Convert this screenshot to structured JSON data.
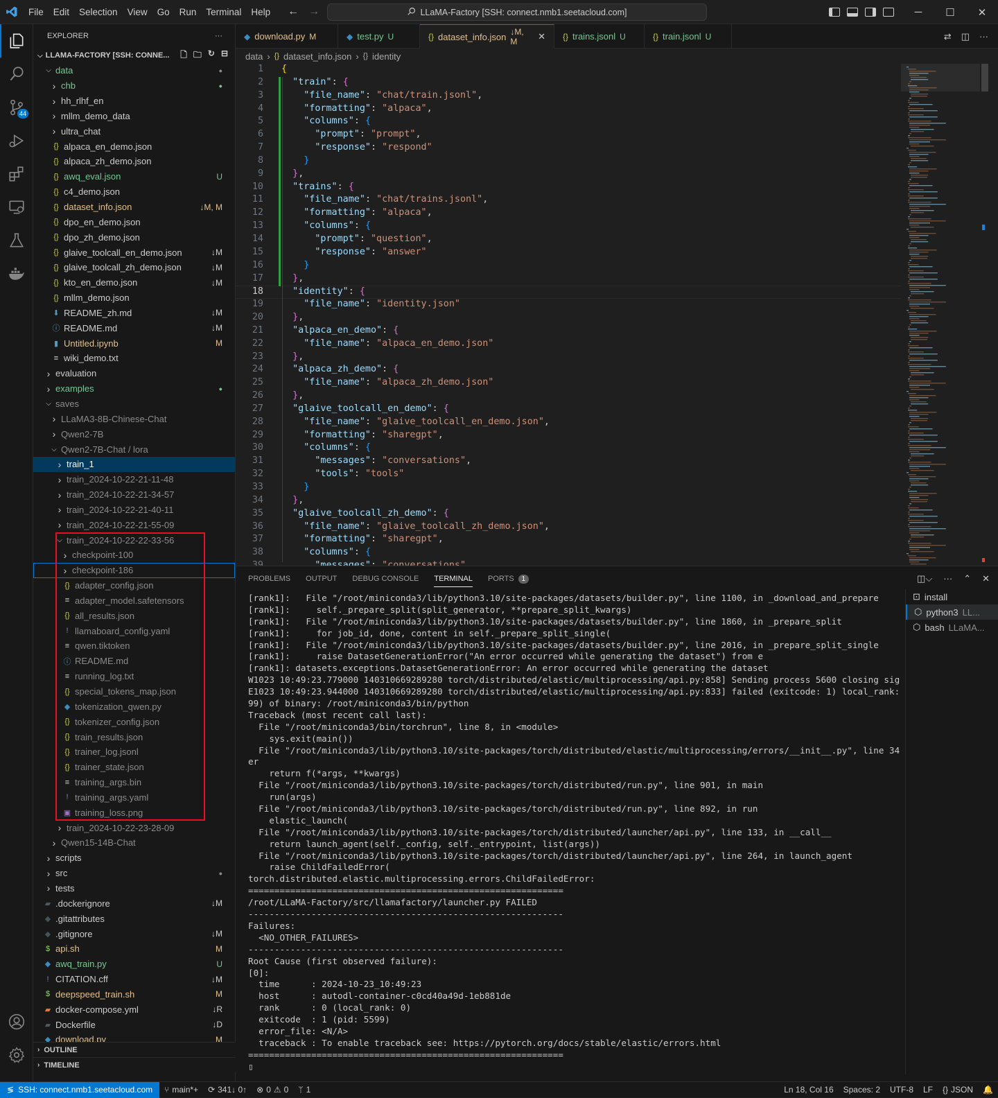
{
  "menu": [
    "File",
    "Edit",
    "Selection",
    "View",
    "Go",
    "Run",
    "Terminal",
    "Help"
  ],
  "window_title": "LLaMA-Factory [SSH: connect.nmb1.seetacloud.com]",
  "activity": {
    "scm_badge": "44"
  },
  "explorer": {
    "header": "EXPLORER",
    "more": "···",
    "root": "LLAMA-FACTORY [SSH: CONNE...",
    "items": [
      {
        "label": "data",
        "depth": 0,
        "type": "folder-open",
        "color": "#73c991",
        "status": "●",
        "status_color": "#8b8b8b"
      },
      {
        "label": "chb",
        "depth": 1,
        "type": "folder",
        "color": "#73c991",
        "status": "●",
        "status_color": "#73c991"
      },
      {
        "label": "hh_rlhf_en",
        "depth": 1,
        "type": "folder",
        "color": "#cccccc",
        "status": ""
      },
      {
        "label": "mllm_demo_data",
        "depth": 1,
        "type": "folder",
        "color": "#cccccc",
        "status": ""
      },
      {
        "label": "ultra_chat",
        "depth": 1,
        "type": "folder",
        "color": "#cccccc",
        "status": ""
      },
      {
        "label": "alpaca_en_demo.json",
        "depth": 1,
        "type": "json",
        "color": "#cccccc",
        "status": ""
      },
      {
        "label": "alpaca_zh_demo.json",
        "depth": 1,
        "type": "json",
        "color": "#cccccc",
        "status": ""
      },
      {
        "label": "awq_eval.json",
        "depth": 1,
        "type": "json",
        "color": "#73c991",
        "status": "U",
        "status_color": "#73c991"
      },
      {
        "label": "c4_demo.json",
        "depth": 1,
        "type": "json",
        "color": "#cccccc",
        "status": ""
      },
      {
        "label": "dataset_info.json",
        "depth": 1,
        "type": "json",
        "color": "#e2c08d",
        "status": "↓M, M",
        "status_color": "#e2c08d"
      },
      {
        "label": "dpo_en_demo.json",
        "depth": 1,
        "type": "json",
        "color": "#cccccc",
        "status": ""
      },
      {
        "label": "dpo_zh_demo.json",
        "depth": 1,
        "type": "json",
        "color": "#cccccc",
        "status": ""
      },
      {
        "label": "glaive_toolcall_en_demo.json",
        "depth": 1,
        "type": "json",
        "color": "#cccccc",
        "status": "↓M",
        "status_color": "#cccccc"
      },
      {
        "label": "glaive_toolcall_zh_demo.json",
        "depth": 1,
        "type": "json",
        "color": "#cccccc",
        "status": "↓M",
        "status_color": "#cccccc"
      },
      {
        "label": "kto_en_demo.json",
        "depth": 1,
        "type": "json",
        "color": "#cccccc",
        "status": "↓M",
        "status_color": "#cccccc"
      },
      {
        "label": "mllm_demo.json",
        "depth": 1,
        "type": "json",
        "color": "#cccccc",
        "status": ""
      },
      {
        "label": "README_zh.md",
        "depth": 1,
        "type": "md-down",
        "color": "#cccccc",
        "status": "↓M",
        "status_color": "#cccccc"
      },
      {
        "label": "README.md",
        "depth": 1,
        "type": "info",
        "color": "#cccccc",
        "status": "↓M",
        "status_color": "#cccccc"
      },
      {
        "label": "Untitled.ipynb",
        "depth": 1,
        "type": "notebook",
        "color": "#e2c08d",
        "status": "M",
        "status_color": "#e2c08d"
      },
      {
        "label": "wiki_demo.txt",
        "depth": 1,
        "type": "text",
        "color": "#cccccc",
        "status": ""
      },
      {
        "label": "evaluation",
        "depth": 0,
        "type": "folder",
        "color": "#cccccc",
        "status": ""
      },
      {
        "label": "examples",
        "depth": 0,
        "type": "folder",
        "color": "#73c991",
        "status": "●",
        "status_color": "#73c991"
      },
      {
        "label": "saves",
        "depth": 0,
        "type": "folder-open",
        "color": "#8b8b8b",
        "status": ""
      },
      {
        "label": "LLaMA3-8B-Chinese-Chat",
        "depth": 1,
        "type": "folder",
        "color": "#8b8b8b",
        "status": ""
      },
      {
        "label": "Qwen2-7B",
        "depth": 1,
        "type": "folder",
        "color": "#8b8b8b",
        "status": ""
      },
      {
        "label": "Qwen2-7B-Chat / lora",
        "depth": 1,
        "type": "folder-open",
        "color": "#8b8b8b",
        "status": ""
      },
      {
        "label": "train_1",
        "depth": 2,
        "type": "folder",
        "color": "#ffffff",
        "status": "",
        "selected": true
      },
      {
        "label": "train_2024-10-22-21-11-48",
        "depth": 2,
        "type": "folder",
        "color": "#8b8b8b",
        "status": ""
      },
      {
        "label": "train_2024-10-22-21-34-57",
        "depth": 2,
        "type": "folder",
        "color": "#8b8b8b",
        "status": ""
      },
      {
        "label": "train_2024-10-22-21-40-11",
        "depth": 2,
        "type": "folder",
        "color": "#8b8b8b",
        "status": ""
      },
      {
        "label": "train_2024-10-22-21-55-09",
        "depth": 2,
        "type": "folder",
        "color": "#8b8b8b",
        "status": ""
      },
      {
        "label": "train_2024-10-22-22-33-56",
        "depth": 2,
        "type": "folder-open",
        "color": "#8b8b8b",
        "status": ""
      },
      {
        "label": "checkpoint-100",
        "depth": 3,
        "type": "folder",
        "color": "#8b8b8b",
        "status": ""
      },
      {
        "label": "checkpoint-186",
        "depth": 3,
        "type": "folder",
        "color": "#8b8b8b",
        "status": "",
        "focus": true
      },
      {
        "label": "adapter_config.json",
        "depth": 3,
        "type": "json",
        "color": "#8b8b8b",
        "status": ""
      },
      {
        "label": "adapter_model.safetensors",
        "depth": 3,
        "type": "text",
        "color": "#8b8b8b",
        "status": ""
      },
      {
        "label": "all_results.json",
        "depth": 3,
        "type": "json",
        "color": "#8b8b8b",
        "status": ""
      },
      {
        "label": "llamaboard_config.yaml",
        "depth": 3,
        "type": "yaml",
        "color": "#8b8b8b",
        "status": ""
      },
      {
        "label": "qwen.tiktoken",
        "depth": 3,
        "type": "text",
        "color": "#8b8b8b",
        "status": ""
      },
      {
        "label": "README.md",
        "depth": 3,
        "type": "info",
        "color": "#8b8b8b",
        "status": ""
      },
      {
        "label": "running_log.txt",
        "depth": 3,
        "type": "text",
        "color": "#8b8b8b",
        "status": ""
      },
      {
        "label": "special_tokens_map.json",
        "depth": 3,
        "type": "json",
        "color": "#8b8b8b",
        "status": ""
      },
      {
        "label": "tokenization_qwen.py",
        "depth": 3,
        "type": "python",
        "color": "#8b8b8b",
        "status": ""
      },
      {
        "label": "tokenizer_config.json",
        "depth": 3,
        "type": "json",
        "color": "#8b8b8b",
        "status": ""
      },
      {
        "label": "train_results.json",
        "depth": 3,
        "type": "json",
        "color": "#8b8b8b",
        "status": ""
      },
      {
        "label": "trainer_log.jsonl",
        "depth": 3,
        "type": "json",
        "color": "#8b8b8b",
        "status": ""
      },
      {
        "label": "trainer_state.json",
        "depth": 3,
        "type": "json",
        "color": "#8b8b8b",
        "status": ""
      },
      {
        "label": "training_args.bin",
        "depth": 3,
        "type": "text",
        "color": "#8b8b8b",
        "status": ""
      },
      {
        "label": "training_args.yaml",
        "depth": 3,
        "type": "yaml",
        "color": "#8b8b8b",
        "status": ""
      },
      {
        "label": "training_loss.png",
        "depth": 3,
        "type": "image",
        "color": "#8b8b8b",
        "status": ""
      },
      {
        "label": "train_2024-10-22-23-28-09",
        "depth": 2,
        "type": "folder",
        "color": "#8b8b8b",
        "status": ""
      },
      {
        "label": "Qwen15-14B-Chat",
        "depth": 1,
        "type": "folder",
        "color": "#8b8b8b",
        "status": ""
      },
      {
        "label": "scripts",
        "depth": 0,
        "type": "folder",
        "color": "#cccccc",
        "status": ""
      },
      {
        "label": "src",
        "depth": 0,
        "type": "folder",
        "color": "#cccccc",
        "status": "●",
        "status_color": "#8b8b8b"
      },
      {
        "label": "tests",
        "depth": 0,
        "type": "folder",
        "color": "#cccccc",
        "status": ""
      },
      {
        "label": ".dockerignore",
        "depth": -1,
        "type": "docker",
        "color": "#cccccc",
        "status": "↓M",
        "status_color": "#cccccc"
      },
      {
        "label": ".gitattributes",
        "depth": -1,
        "type": "git",
        "color": "#cccccc",
        "status": ""
      },
      {
        "label": ".gitignore",
        "depth": -1,
        "type": "git",
        "color": "#cccccc",
        "status": "↓M",
        "status_color": "#cccccc"
      },
      {
        "label": "api.sh",
        "depth": -1,
        "type": "shell",
        "color": "#e2c08d",
        "status": "M",
        "status_color": "#e2c08d"
      },
      {
        "label": "awq_train.py",
        "depth": -1,
        "type": "python",
        "color": "#73c991",
        "status": "U",
        "status_color": "#73c991"
      },
      {
        "label": "CITATION.cff",
        "depth": -1,
        "type": "yaml",
        "color": "#cccccc",
        "status": "↓M",
        "status_color": "#cccccc"
      },
      {
        "label": "deepspeed_train.sh",
        "depth": -1,
        "type": "shell",
        "color": "#e2c08d",
        "status": "M",
        "status_color": "#e2c08d"
      },
      {
        "label": "docker-compose.yml",
        "depth": -1,
        "type": "compose",
        "color": "#cccccc",
        "status": "↓R",
        "status_color": "#cccccc"
      },
      {
        "label": "Dockerfile",
        "depth": -1,
        "type": "docker",
        "color": "#cccccc",
        "status": "↓D",
        "status_color": "#cccccc"
      },
      {
        "label": "download.py",
        "depth": -1,
        "type": "python",
        "color": "#e2c08d",
        "status": "M",
        "status_color": "#e2c08d"
      }
    ],
    "outline": "OUTLINE",
    "timeline": "TIMELINE"
  },
  "tabs": [
    {
      "label": "download.py",
      "status": "M",
      "icon": "python",
      "color": "#e2c08d",
      "active": false
    },
    {
      "label": "test.py",
      "status": "U",
      "icon": "python",
      "color": "#73c991",
      "active": false
    },
    {
      "label": "dataset_info.json",
      "status": "↓M, M",
      "icon": "json",
      "color": "#e2c08d",
      "active": true
    },
    {
      "label": "trains.jsonl",
      "status": "U",
      "icon": "json",
      "color": "#73c991",
      "active": false
    },
    {
      "label": "train.jsonl",
      "status": "U",
      "icon": "json",
      "color": "#73c991",
      "active": false
    }
  ],
  "breadcrumb": {
    "folder": "data",
    "file": "dataset_info.json",
    "symbol": "identity"
  },
  "code": {
    "current_line": 18,
    "lines": [
      "{",
      "  \"train\": {",
      "    \"file_name\": \"chat/train.jsonl\",",
      "    \"formatting\": \"alpaca\",",
      "    \"columns\": {",
      "      \"prompt\": \"prompt\",",
      "      \"response\": \"respond\"",
      "    }",
      "  },",
      "  \"trains\": {",
      "    \"file_name\": \"chat/trains.jsonl\",",
      "    \"formatting\": \"alpaca\",",
      "    \"columns\": {",
      "      \"prompt\": \"question\",",
      "      \"response\": \"answer\"",
      "    }",
      "  },",
      "  \"identity\": {",
      "    \"file_name\": \"identity.json\"",
      "  },",
      "  \"alpaca_en_demo\": {",
      "    \"file_name\": \"alpaca_en_demo.json\"",
      "  },",
      "  \"alpaca_zh_demo\": {",
      "    \"file_name\": \"alpaca_zh_demo.json\"",
      "  },",
      "  \"glaive_toolcall_en_demo\": {",
      "    \"file_name\": \"glaive_toolcall_en_demo.json\",",
      "    \"formatting\": \"sharegpt\",",
      "    \"columns\": {",
      "      \"messages\": \"conversations\",",
      "      \"tools\": \"tools\"",
      "    }",
      "  },",
      "  \"glaive_toolcall_zh_demo\": {",
      "    \"file_name\": \"glaive_toolcall_zh_demo.json\",",
      "    \"formatting\": \"sharegpt\",",
      "    \"columns\": {",
      "      \"messages\": \"conversations\","
    ]
  },
  "panel": {
    "tabs": [
      "PROBLEMS",
      "OUTPUT",
      "DEBUG CONSOLE",
      "TERMINAL",
      "PORTS"
    ],
    "active_tab": "TERMINAL",
    "ports_count": "1",
    "terminal_lines": [
      "[rank1]:   File \"/root/miniconda3/lib/python3.10/site-packages/datasets/builder.py\", line 1100, in _download_and_prepare",
      "[rank1]:     self._prepare_split(split_generator, **prepare_split_kwargs)",
      "[rank1]:   File \"/root/miniconda3/lib/python3.10/site-packages/datasets/builder.py\", line 1860, in _prepare_split",
      "[rank1]:     for job_id, done, content in self._prepare_split_single(",
      "[rank1]:   File \"/root/miniconda3/lib/python3.10/site-packages/datasets/builder.py\", line 2016, in _prepare_split_single",
      "[rank1]:     raise DatasetGenerationError(\"An error occurred while generating the dataset\") from e",
      "[rank1]: datasets.exceptions.DatasetGenerationError: An error occurred while generating the dataset",
      "W1023 10:49:23.779000 140310669289280 torch/distributed/elastic/multiprocessing/api.py:858] Sending process 5600 closing signal SIGTERM",
      "E1023 10:49:23.944000 140310669289280 torch/distributed/elastic/multiprocessing/api.py:833] failed (exitcode: 1) local_rank: 0 (pid: 55",
      "99) of binary: /root/miniconda3/bin/python",
      "Traceback (most recent call last):",
      "  File \"/root/miniconda3/bin/torchrun\", line 8, in <module>",
      "    sys.exit(main())",
      "  File \"/root/miniconda3/lib/python3.10/site-packages/torch/distributed/elastic/multiprocessing/errors/__init__.py\", line 348, in wrapp",
      "er",
      "    return f(*args, **kwargs)",
      "  File \"/root/miniconda3/lib/python3.10/site-packages/torch/distributed/run.py\", line 901, in main",
      "    run(args)",
      "  File \"/root/miniconda3/lib/python3.10/site-packages/torch/distributed/run.py\", line 892, in run",
      "    elastic_launch(",
      "  File \"/root/miniconda3/lib/python3.10/site-packages/torch/distributed/launcher/api.py\", line 133, in __call__",
      "    return launch_agent(self._config, self._entrypoint, list(args))",
      "  File \"/root/miniconda3/lib/python3.10/site-packages/torch/distributed/launcher/api.py\", line 264, in launch_agent",
      "    raise ChildFailedError(",
      "torch.distributed.elastic.multiprocessing.errors.ChildFailedError:",
      "============================================================",
      "/root/LLaMA-Factory/src/llamafactory/launcher.py FAILED",
      "------------------------------------------------------------",
      "Failures:",
      "  <NO_OTHER_FAILURES>",
      "------------------------------------------------------------",
      "Root Cause (first observed failure):",
      "[0]:",
      "  time      : 2024-10-23_10:49:23",
      "  host      : autodl-container-c0cd40a49d-1eb881de",
      "  rank      : 0 (local_rank: 0)",
      "  exitcode  : 1 (pid: 5599)",
      "  error_file: <N/A>",
      "  traceback : To enable traceback see: https://pytorch.org/docs/stable/elastic/errors.html",
      "============================================================",
      "▯"
    ],
    "terminals": [
      {
        "icon": "terminal-icon",
        "name": "install",
        "sub": ""
      },
      {
        "icon": "python-icon",
        "name": "python3",
        "sub": "LL...",
        "selected": true
      },
      {
        "icon": "bash-icon",
        "name": "bash",
        "sub": "LLaMA..."
      }
    ]
  },
  "status": {
    "remote": "SSH: connect.nmb1.seetacloud.com",
    "branch": "main*+",
    "sync": "341↓ 0↑",
    "errors": "0",
    "warnings": "0",
    "ports": "1",
    "position": "Ln 18, Col 16",
    "spaces": "Spaces: 2",
    "encoding": "UTF-8",
    "eol": "LF",
    "language": "JSON"
  },
  "colors": {
    "accent": "#0078d4",
    "modified": "#e2c08d",
    "untracked": "#73c991",
    "highlight_box": "#e81123"
  }
}
